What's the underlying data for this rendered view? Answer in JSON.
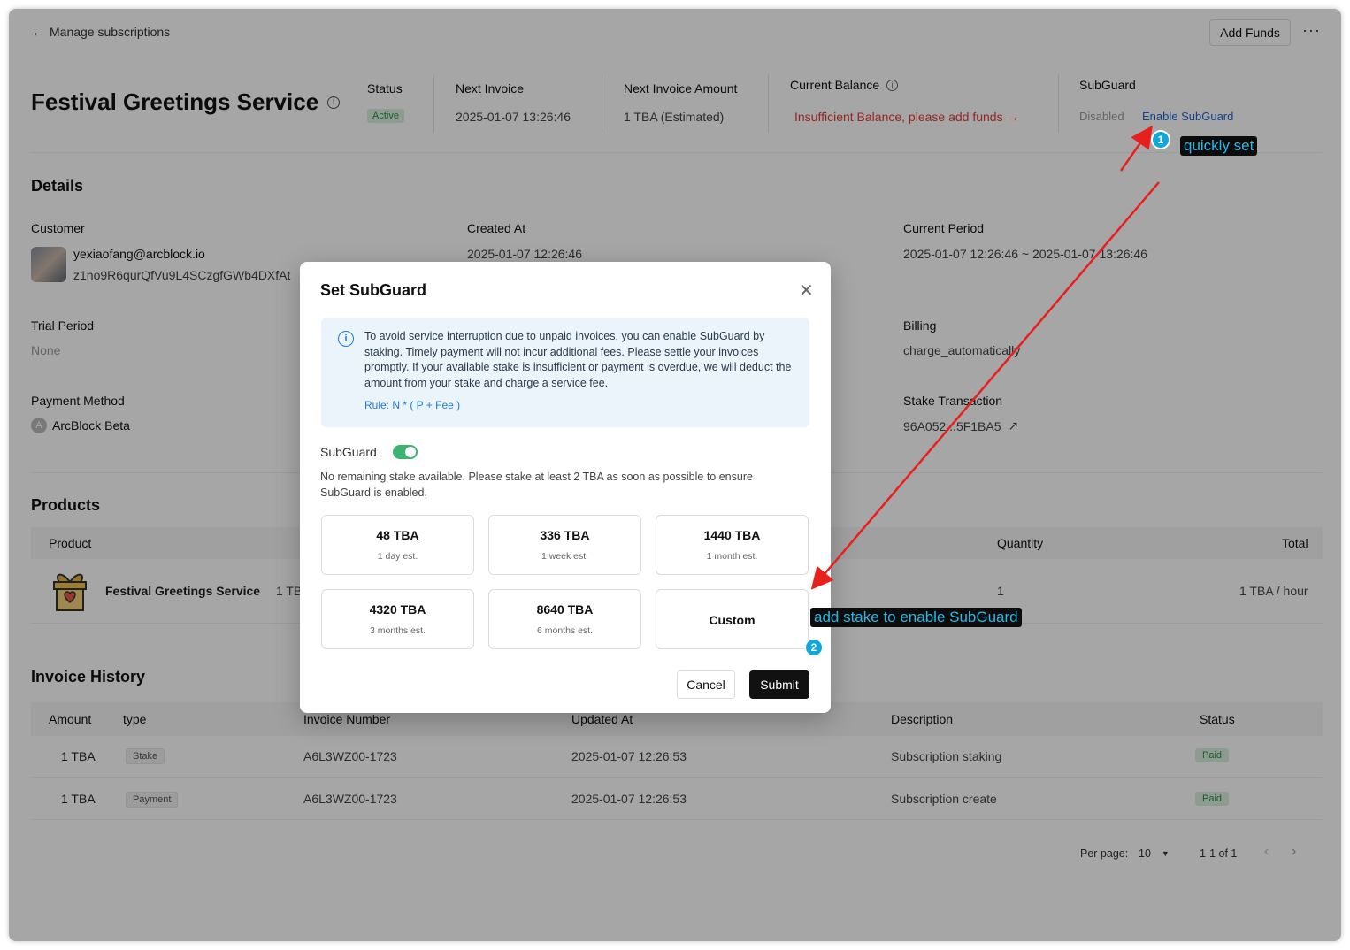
{
  "topbar": {
    "back_label": "Manage subscriptions",
    "add_funds": "Add Funds",
    "more": "···"
  },
  "header": {
    "title": "Festival Greetings Service",
    "status_label": "Status",
    "status_value": "Active",
    "next_invoice_label": "Next Invoice",
    "next_invoice_value": "2025-01-07 13:26:46",
    "next_amount_label": "Next Invoice Amount",
    "next_amount_value": "1 TBA (Estimated)",
    "balance_label": "Current Balance",
    "balance_value": "Insufficient Balance, please add funds",
    "subguard_label": "SubGuard",
    "subguard_state": "Disabled",
    "subguard_link": "Enable SubGuard"
  },
  "details": {
    "title": "Details",
    "customer_label": "Customer",
    "customer_email": "yexiaofang@arcblock.io",
    "customer_did": "z1no9R6qurQfVu9L4SCzgfGWb4DXfAt",
    "created_label": "Created At",
    "created_value": "2025-01-07 12:26:46",
    "period_label": "Current Period",
    "period_value": "2025-01-07 12:26:46 ~ 2025-01-07 13:26:46",
    "trial_label": "Trial Period",
    "trial_value": "None",
    "billing_label": "Billing",
    "billing_value": "charge_automatically",
    "payment_label": "Payment Method",
    "payment_avatar": "A",
    "payment_value": "ArcBlock Beta",
    "stake_label": "Stake Transaction",
    "stake_value": "96A052...5F1BA5"
  },
  "products": {
    "title": "Products",
    "col_product": "Product",
    "col_quantity": "Quantity",
    "col_total": "Total",
    "row_name": "Festival Greetings Service",
    "row_price": "1 TB",
    "row_quantity": "1",
    "row_total": "1 TBA / hour"
  },
  "invoices": {
    "title": "Invoice History",
    "columns": [
      "Amount",
      "type",
      "Invoice Number",
      "Updated At",
      "Description",
      "Status"
    ],
    "rows": [
      {
        "amount": "1 TBA",
        "type": "Stake",
        "number": "A6L3WZ00-1723",
        "updated": "2025-01-07 12:26:53",
        "description": "Subscription staking",
        "status": "Paid"
      },
      {
        "amount": "1 TBA",
        "type": "Payment",
        "number": "A6L3WZ00-1723",
        "updated": "2025-01-07 12:26:53",
        "description": "Subscription create",
        "status": "Paid"
      }
    ],
    "per_page_label": "Per page:",
    "per_page_value": "10",
    "range": "1-1 of 1"
  },
  "modal": {
    "title": "Set SubGuard",
    "notice": "To avoid service interruption due to unpaid invoices, you can enable SubGuard by staking. Timely payment will not incur additional fees. Please settle your invoices promptly. If your available stake is insufficient or payment is overdue, we will deduct the amount from your stake and charge a service fee.",
    "rule": "Rule: N * ( P + Fee )",
    "toggle_label": "SubGuard",
    "stake_warning": "No remaining stake available. Please stake at least 2 TBA as soon as possible to ensure SubGuard is enabled.",
    "options": [
      {
        "amount": "48 TBA",
        "est": "1 day est."
      },
      {
        "amount": "336 TBA",
        "est": "1 week est."
      },
      {
        "amount": "1440 TBA",
        "est": "1 month est."
      },
      {
        "amount": "4320 TBA",
        "est": "3 months est."
      },
      {
        "amount": "8640 TBA",
        "est": "6 months est."
      },
      {
        "amount": "Custom",
        "est": ""
      }
    ],
    "cancel": "Cancel",
    "submit": "Submit"
  },
  "annotations": {
    "step1": "1",
    "callout1": "quickly set",
    "step2": "2",
    "callout2": "add stake to enable SubGuard",
    "arrow_color": "#e8201c"
  }
}
